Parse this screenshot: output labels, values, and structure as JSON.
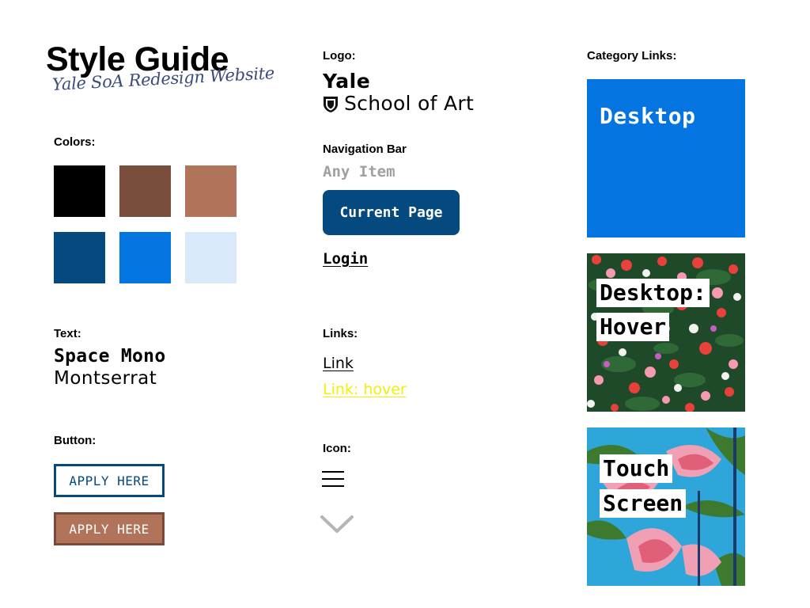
{
  "header": {
    "title": "Style Guide",
    "subtitle": "Yale SoA Redesign Website"
  },
  "colors": {
    "label": "Colors:",
    "swatches": [
      "#000000",
      "#7a4d3c",
      "#b1745b",
      "#054a7f",
      "#0474e0",
      "#dae9f9"
    ]
  },
  "text": {
    "label": "Text:",
    "samples": [
      "Space Mono",
      "Montserrat"
    ]
  },
  "button": {
    "label": "Button:",
    "outline_label": "APPLY HERE",
    "filled_label": "APPLY HERE"
  },
  "logo": {
    "label": "Logo:",
    "line1": "Yale",
    "line2": "School of Art",
    "icon": "shield-icon"
  },
  "navigation": {
    "label": "Navigation Bar",
    "item": "Any Item",
    "current": "Current Page",
    "login": "Login"
  },
  "links": {
    "label": "Links:",
    "normal": "Link",
    "hover": "Link: hover",
    "hover_color": "#f2ef0a"
  },
  "icon": {
    "label": "Icon:",
    "icons": [
      "menu-icon",
      "chevron-down-icon"
    ]
  },
  "category_links": {
    "label": "Category Links:",
    "desktop": "Desktop",
    "hover_line1": "Desktop:",
    "hover_line2": "Hover",
    "touch_line1": "Touch",
    "touch_line2": "Screen",
    "desktop_color": "#0474e0"
  }
}
